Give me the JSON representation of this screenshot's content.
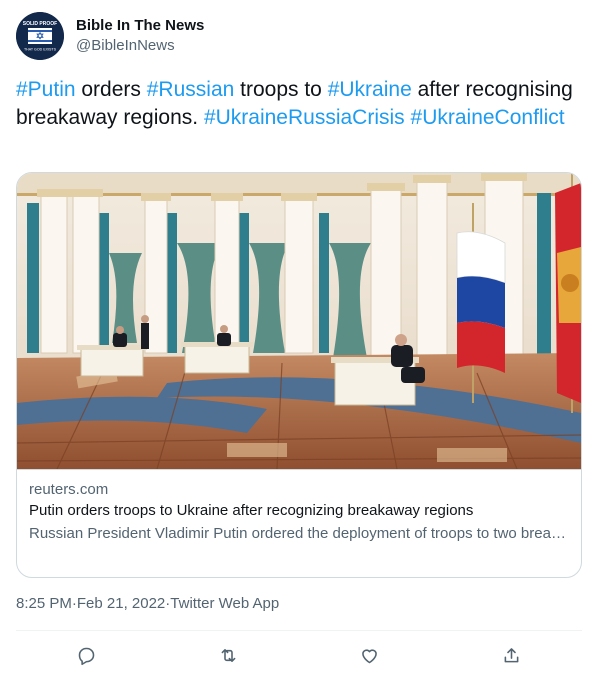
{
  "author": {
    "display_name": "Bible In The News",
    "handle": "@BibleInNews",
    "avatar_top_text": "SOLID PROOF",
    "avatar_bottom_text": "THAT GOD EXISTS"
  },
  "tweet": {
    "segments": [
      {
        "text": "#Putin",
        "type": "hashtag"
      },
      {
        "text": " orders ",
        "type": "plain"
      },
      {
        "text": "#Russian",
        "type": "hashtag"
      },
      {
        "text": " troops to ",
        "type": "plain"
      },
      {
        "text": "#Ukraine",
        "type": "hashtag"
      },
      {
        "text": " after recognising breakaway regions. ",
        "type": "plain"
      },
      {
        "text": "#UkraineRussiaCrisis",
        "type": "hashtag"
      },
      {
        "text": " ",
        "type": "plain"
      },
      {
        "text": "#UkraineConflict",
        "type": "hashtag"
      }
    ]
  },
  "card": {
    "domain": "reuters.com",
    "title": "Putin orders troops to Ukraine after recognizing breakaway regions",
    "description": "Russian President Vladimir Putin ordered the deployment of troops to two breakaway regions in eastern Ukraine after recognising them as independent o..."
  },
  "meta": {
    "time": "8:25 PM",
    "separator": " · ",
    "date": "Feb 21, 2022",
    "source": "Twitter Web App"
  },
  "actions": [
    {
      "name": "reply-icon"
    },
    {
      "name": "retweet-icon"
    },
    {
      "name": "like-icon"
    },
    {
      "name": "share-icon"
    }
  ],
  "colors": {
    "link": "#1d9bf0",
    "secondary_text": "#536471",
    "border": "#cfd9de",
    "primary_text": "#0f1419"
  }
}
